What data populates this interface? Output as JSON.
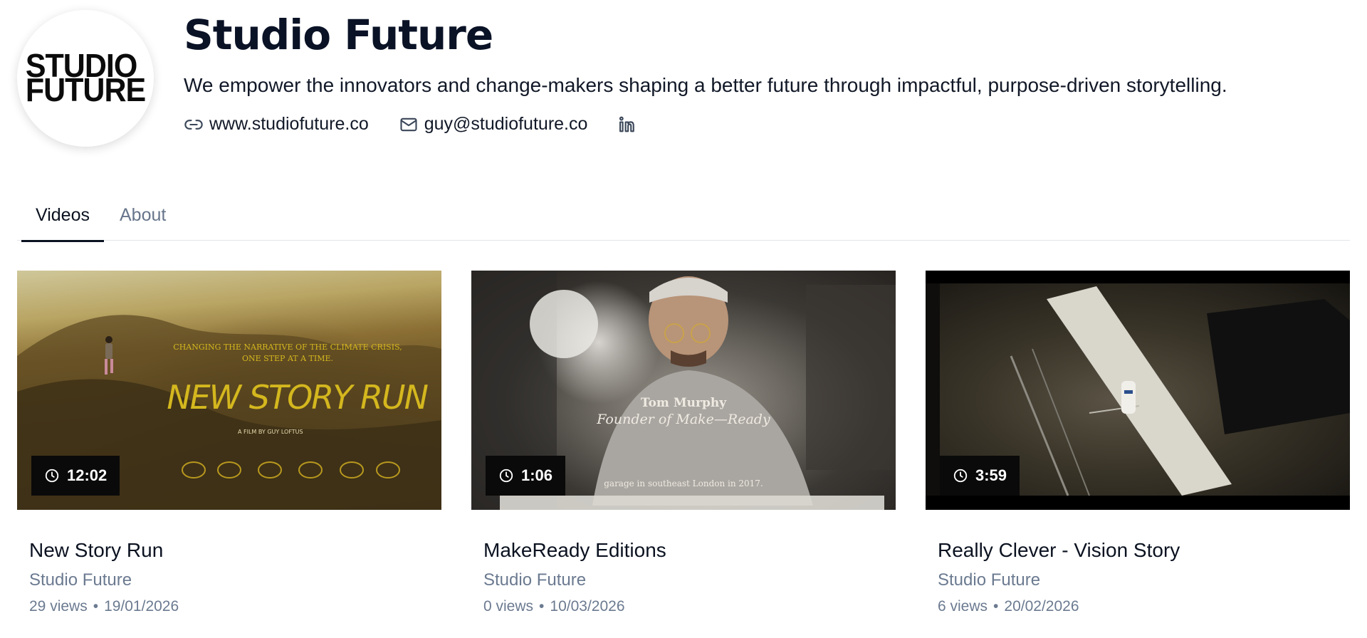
{
  "channel": {
    "logo_line1": "STUDIO",
    "logo_line2": "FUTURE",
    "name": "Studio Future",
    "tagline": "We empower the innovators and change-makers shaping a better future through impactful, purpose-driven storytelling.",
    "website": "www.studiofuture.co",
    "email": "guy@studiofuture.co",
    "linkedin_icon": "linkedin-icon"
  },
  "tabs": [
    {
      "label": "Videos",
      "active": true
    },
    {
      "label": "About",
      "active": false
    }
  ],
  "videos": [
    {
      "title": "New Story Run",
      "channel": "Studio Future",
      "views": "29 views",
      "date": "19/01/2026",
      "duration": "12:02",
      "thumb_text": {
        "tagline1": "CHANGING THE NARRATIVE OF THE CLIMATE CRISIS,",
        "tagline2": "ONE STEP AT A TIME.",
        "headline": "NEW STORY RUN",
        "credit": "A FILM BY GUY LOFTUS"
      }
    },
    {
      "title": "MakeReady Editions",
      "channel": "Studio Future",
      "views": "0 views",
      "date": "10/03/2026",
      "duration": "1:06",
      "thumb_text": {
        "name": "Tom Murphy",
        "role": "Founder of Make—Ready",
        "caption": "garage in southeast London in 2017."
      }
    },
    {
      "title": "Really Clever - Vision Story",
      "channel": "Studio Future",
      "views": "6 views",
      "date": "20/02/2026",
      "duration": "3:59"
    }
  ],
  "colors": {
    "accent": "#0b1220",
    "muted": "#6b7a90",
    "badge_bg": "#0a0a0a",
    "headline_gold": "#d4b71e"
  }
}
